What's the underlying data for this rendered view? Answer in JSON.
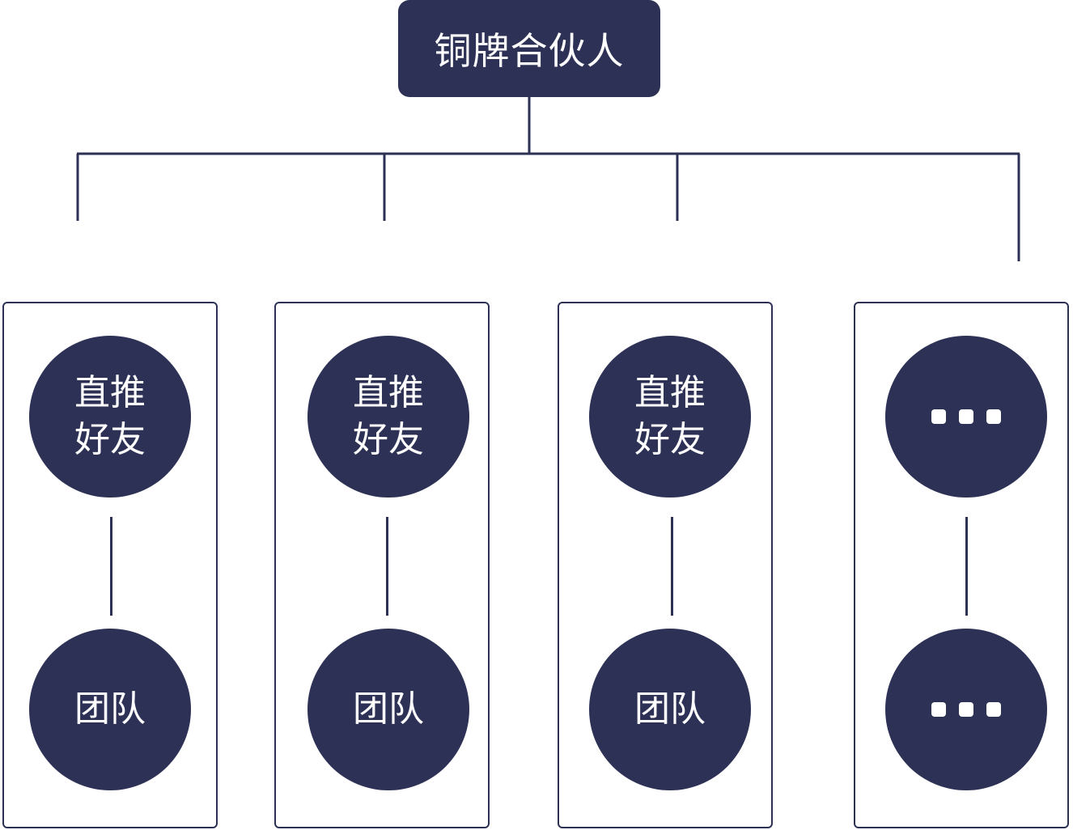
{
  "root": {
    "label": "铜牌合伙人"
  },
  "columns": [
    {
      "top_label": "直推好友",
      "bottom_label": "团队"
    },
    {
      "top_label": "直推好友",
      "bottom_label": "团队"
    },
    {
      "top_label": "直推好友",
      "bottom_label": "团队"
    },
    {
      "top_label": "",
      "bottom_label": "",
      "top_icon": "ellipsis-icon",
      "bottom_icon": "ellipsis-icon"
    }
  ],
  "colors": {
    "node_fill": "#2d3155",
    "line": "#2d3155",
    "text": "#ffffff",
    "background": "#ffffff"
  }
}
